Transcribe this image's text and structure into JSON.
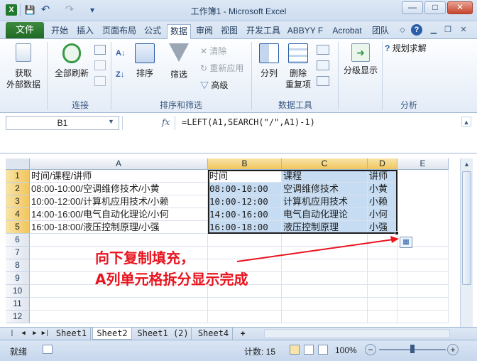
{
  "window": {
    "title": "工作簿1 - Microsoft Excel",
    "minimize": "—",
    "maximize": "□",
    "close": "✕"
  },
  "quick_access": {
    "save": "💾",
    "undo": "↶",
    "redo": "↷",
    "customize": "▾"
  },
  "tabs": {
    "file": "文件",
    "items": [
      "开始",
      "插入",
      "页面布局",
      "公式",
      "数据",
      "审阅",
      "视图",
      "开发工具",
      "ABBYY F",
      "Acrobat",
      "团队"
    ],
    "active": "数据"
  },
  "ribbon": {
    "groups": {
      "connections": "连接",
      "sort_filter": "排序和筛选",
      "data_tools": "数据工具",
      "analysis": "分析"
    },
    "get_external": "获取\n外部数据",
    "refresh_all": "全部刷新",
    "sort": "排序",
    "filter": "筛选",
    "clear": "清除",
    "reapply": "重新应用",
    "advanced": "高级",
    "split": "分列",
    "remove_dup": "删除\n重复项",
    "outline": "分级显示",
    "solver": "规划求解"
  },
  "formula_bar": {
    "name_box": "B1",
    "fx": "fx",
    "formula": "=LEFT(A1,SEARCH(\"/\",A1)-1)"
  },
  "columns": [
    "A",
    "B",
    "C",
    "D",
    "E"
  ],
  "rows": [
    "1",
    "2",
    "3",
    "4",
    "5",
    "6",
    "7",
    "8",
    "9",
    "10",
    "11",
    "12"
  ],
  "cells": [
    [
      "时间/课程/讲师",
      "时间",
      "课程",
      "讲师"
    ],
    [
      "08:00-10:00/空调维修技术/小黄",
      "08:00-10:00",
      "空调维修技术",
      "小黄"
    ],
    [
      "10:00-12:00/计算机应用技术/小赖",
      "10:00-12:00",
      "计算机应用技术",
      "小赖"
    ],
    [
      "14:00-16:00/电气自动化理论/小何",
      "14:00-16:00",
      "电气自动化理论",
      "小何"
    ],
    [
      "16:00-18:00/液压控制原理/小强",
      "16:00-18:00",
      "液压控制原理",
      "小强"
    ]
  ],
  "annotation": {
    "line1": "向下复制填充，",
    "line2": "A列单元格拆分显示完成"
  },
  "sheets": [
    "Sheet1",
    "Sheet2",
    "Sheet1 (2)",
    "Sheet4"
  ],
  "active_sheet": "Sheet2",
  "status": {
    "ready": "就绪",
    "count": "计数: 15",
    "zoom": "100%"
  },
  "colors": {
    "accent": "#2a5ea8",
    "selection_fill": "#c6dcf2",
    "annotation": "#e8141f"
  }
}
